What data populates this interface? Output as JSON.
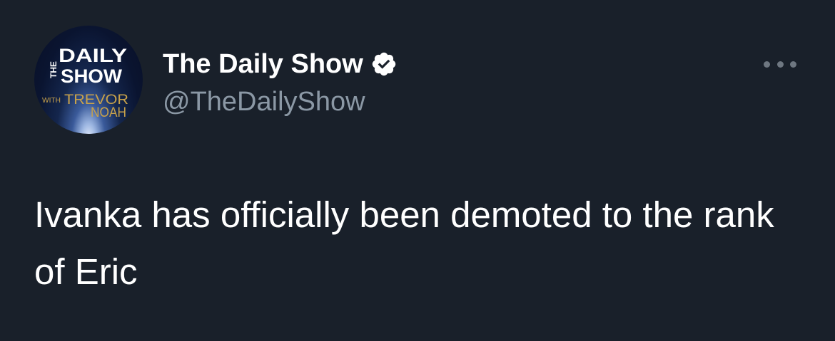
{
  "author": {
    "display_name": "The Daily Show",
    "handle": "@TheDailyShow",
    "verified": true,
    "avatar": {
      "logo_text_the": "THE",
      "logo_text_daily": "DAILY",
      "logo_text_show": "SHOW",
      "logo_text_with": "WITH",
      "logo_text_trevor": "TREVOR",
      "logo_text_noah": "NOAH"
    }
  },
  "tweet": {
    "text": "Ivanka has officially been demoted to the rank of Eric"
  },
  "icons": {
    "verified": "verified-badge-icon",
    "more": "more-options-icon"
  },
  "colors": {
    "background": "#19202a",
    "name": "#ffffff",
    "handle": "#8b98a5",
    "logo_gold": "#c9a24a"
  }
}
